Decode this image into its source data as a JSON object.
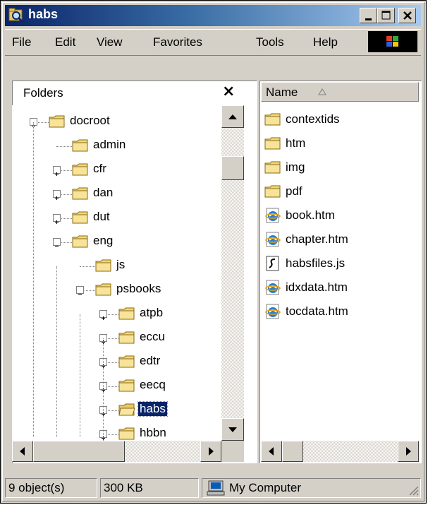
{
  "window": {
    "title": "habs",
    "buttons": {
      "minimize": "_",
      "maximize": "□",
      "close": "✕"
    }
  },
  "menu": {
    "items": [
      "File",
      "Edit",
      "View",
      "Favorites",
      "Tools",
      "Help"
    ]
  },
  "folders": {
    "label": "Folders",
    "close": "×",
    "tree": [
      {
        "label": "docroot",
        "expander": "minus"
      },
      {
        "label": "admin",
        "expander": "none"
      },
      {
        "label": "cfr",
        "expander": "plus"
      },
      {
        "label": "dan",
        "expander": "plus"
      },
      {
        "label": "dut",
        "expander": "plus"
      },
      {
        "label": "eng",
        "expander": "minus"
      },
      {
        "label": "js",
        "expander": "none"
      },
      {
        "label": "psbooks",
        "expander": "minus"
      },
      {
        "label": "atpb",
        "expander": "plus"
      },
      {
        "label": "eccu",
        "expander": "plus"
      },
      {
        "label": "edtr",
        "expander": "plus"
      },
      {
        "label": "eecq",
        "expander": "plus"
      },
      {
        "label": "habs",
        "expander": "plus",
        "selected": true
      },
      {
        "label": "hbbn",
        "expander": "plus"
      }
    ]
  },
  "files": {
    "column": "Name",
    "items": [
      {
        "label": "contextids",
        "icon": "folder-icon"
      },
      {
        "label": "htm",
        "icon": "folder-icon"
      },
      {
        "label": "img",
        "icon": "folder-icon"
      },
      {
        "label": "pdf",
        "icon": "folder-icon"
      },
      {
        "label": "book.htm",
        "icon": "ie-document-icon"
      },
      {
        "label": "chapter.htm",
        "icon": "ie-document-icon"
      },
      {
        "label": "habsfiles.js",
        "icon": "script-file-icon"
      },
      {
        "label": "idxdata.htm",
        "icon": "ie-document-icon"
      },
      {
        "label": "tocdata.htm",
        "icon": "ie-document-icon"
      }
    ]
  },
  "status": {
    "objects": "9 object(s)",
    "size": "300 KB",
    "zone": "My Computer"
  },
  "colors": {
    "title_gradient_start": "#0a246a",
    "title_gradient_end": "#a6caf0",
    "face": "#d4d0c8",
    "selection": "#0a246a"
  }
}
